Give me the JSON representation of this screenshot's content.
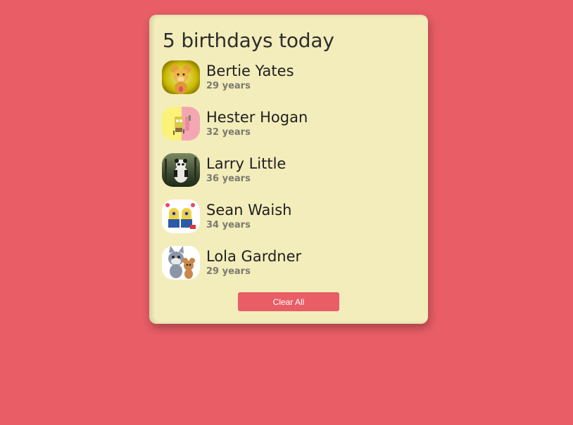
{
  "header": {
    "title": "5 birthdays today"
  },
  "people": [
    {
      "name": "Bertie Yates",
      "age": "29 years",
      "avatar": "bear-cartoon-avatar"
    },
    {
      "name": "Hester Hogan",
      "age": "32 years",
      "avatar": "sponge-cartoon-avatar"
    },
    {
      "name": "Larry Little",
      "age": "36 years",
      "avatar": "panda-cartoon-avatar"
    },
    {
      "name": "Sean Waish",
      "age": "34 years",
      "avatar": "minions-cartoon-avatar"
    },
    {
      "name": "Lola Gardner",
      "age": "29 years",
      "avatar": "cat-mouse-cartoon-avatar"
    }
  ],
  "actions": {
    "clear_label": "Clear All"
  },
  "colors": {
    "background": "#e85d66",
    "card": "#f3edbb",
    "button": "#e85d66"
  }
}
